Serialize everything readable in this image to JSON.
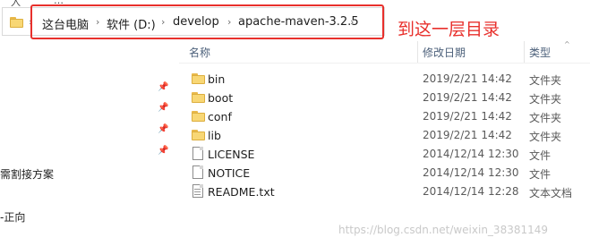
{
  "top_fragments": [
    "入",
    "…"
  ],
  "address_bar": {
    "crumbs": [
      "这台电脑",
      "软件 (D:)",
      "develop",
      "apache-maven-3.2.5"
    ]
  },
  "annotation": "到这一层目录",
  "left_pane": {
    "texts": [
      "需割接方案",
      "-正向"
    ]
  },
  "columns": {
    "name": "名称",
    "date": "修改日期",
    "type": "类型"
  },
  "files": [
    {
      "name": "bin",
      "date": "2019/2/21 14:42",
      "type": "文件夹",
      "icon": "folder-icon"
    },
    {
      "name": "boot",
      "date": "2019/2/21 14:42",
      "type": "文件夹",
      "icon": "folder-icon"
    },
    {
      "name": "conf",
      "date": "2019/2/21 14:42",
      "type": "文件夹",
      "icon": "folder-icon"
    },
    {
      "name": "lib",
      "date": "2019/2/21 14:42",
      "type": "文件夹",
      "icon": "folder-icon"
    },
    {
      "name": "LICENSE",
      "date": "2014/12/14 12:30",
      "type": "文件",
      "icon": "file-icon"
    },
    {
      "name": "NOTICE",
      "date": "2014/12/14 12:30",
      "type": "文件",
      "icon": "file-icon"
    },
    {
      "name": "README.txt",
      "date": "2014/12/14 12:28",
      "type": "文本文档",
      "icon": "text-file-icon"
    }
  ],
  "watermark": "https://blog.csdn.net/weixin_38381149",
  "colors": {
    "annotation_red": "#e8302c",
    "folder_yellow": "#f8d775",
    "header_text": "#4c607a"
  }
}
